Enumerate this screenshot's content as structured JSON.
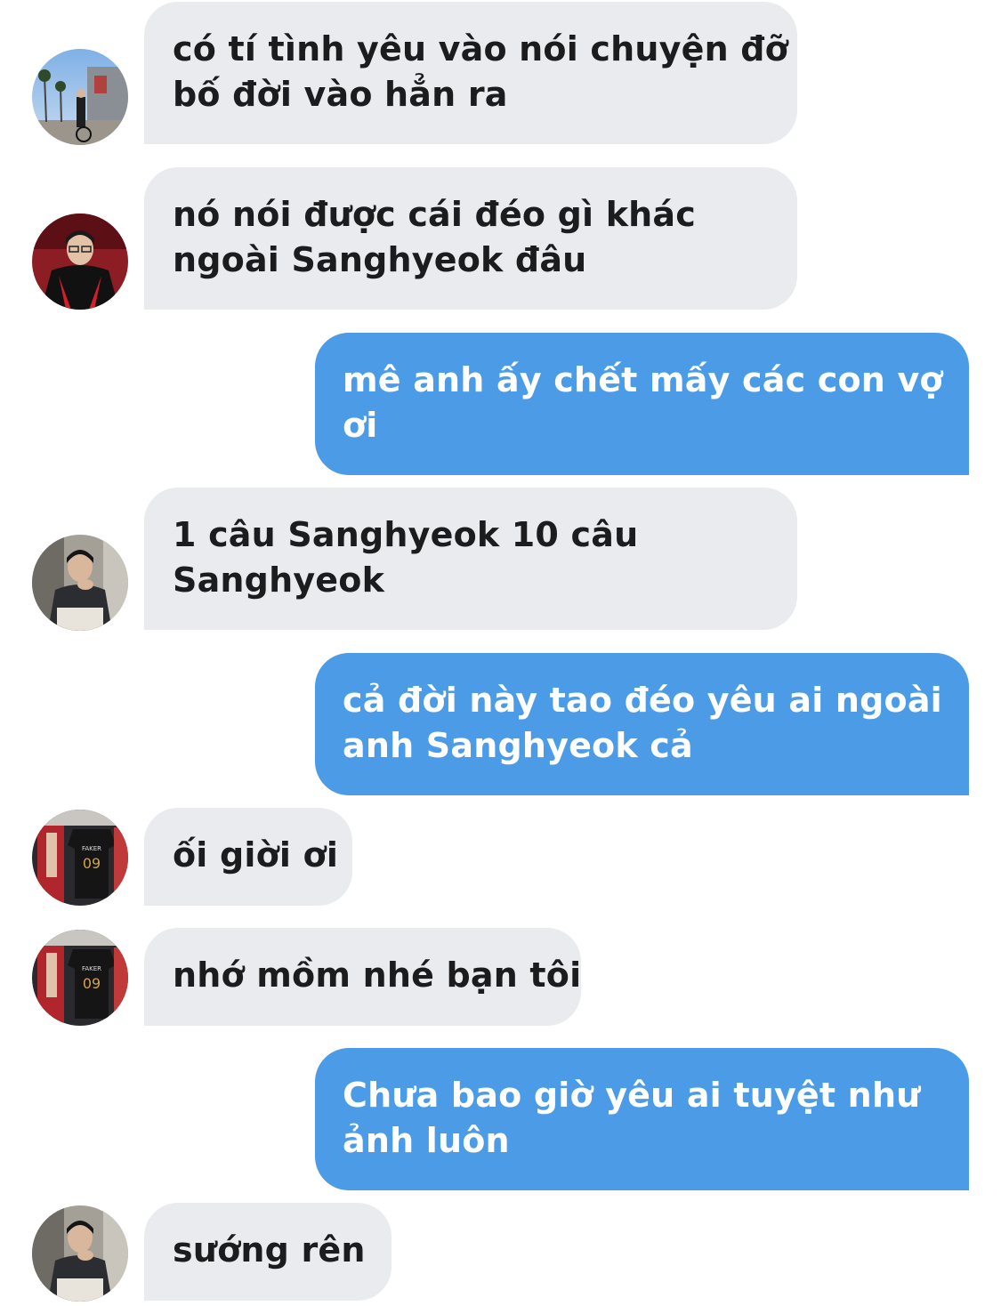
{
  "messages": [
    {
      "direction": "incoming",
      "avatar": "avatar-street-photo",
      "lines": [
        "có tí tình yêu vào nói chuyện đỡ",
        "bố đời vào hẳn ra"
      ]
    },
    {
      "direction": "incoming",
      "avatar": "avatar-red-jacket",
      "lines": [
        "nó nói được cái đéo gì khác",
        "ngoài Sanghyeok đâu"
      ]
    },
    {
      "direction": "outgoing",
      "lines": [
        "mê anh ấy chết mấy các con vợ",
        "ơi"
      ]
    },
    {
      "direction": "incoming",
      "avatar": "avatar-seated-man",
      "lines": [
        "1 câu Sanghyeok 10 câu",
        "Sanghyeok"
      ]
    },
    {
      "direction": "outgoing",
      "lines": [
        "cả đời này tao đéo yêu ai ngoài",
        "anh Sanghyeok cả"
      ]
    },
    {
      "direction": "incoming",
      "avatar": "avatar-jersey-display",
      "lines": [
        "ối giời ơi"
      ]
    },
    {
      "direction": "incoming",
      "avatar": "avatar-jersey-display",
      "lines": [
        "nhớ mồm nhé bạn tôi"
      ]
    },
    {
      "direction": "outgoing",
      "lines": [
        "Chưa bao giờ yêu ai tuyệt như",
        "ảnh luôn"
      ]
    },
    {
      "direction": "incoming",
      "avatar": "avatar-seated-man",
      "lines": [
        "sướng rên"
      ]
    }
  ],
  "colors": {
    "incoming_bubble": "#e9ebef",
    "incoming_text": "#1c1c1e",
    "outgoing_bubble": "#4b9be7",
    "outgoing_text": "#ffffff",
    "background": "#ffffff"
  }
}
